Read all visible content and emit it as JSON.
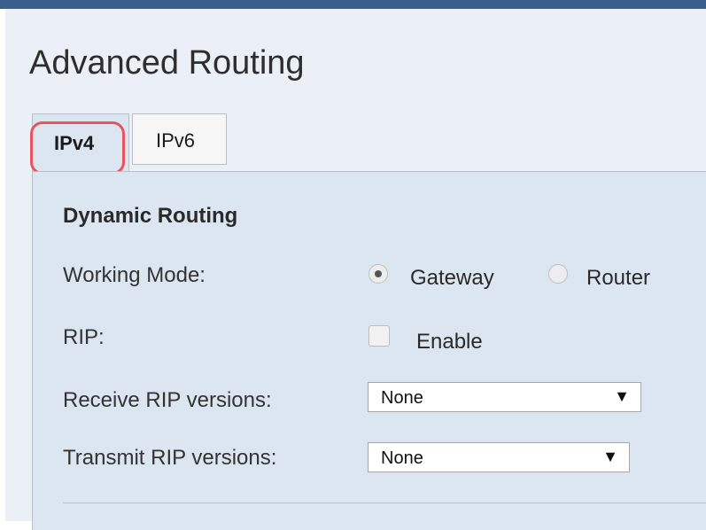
{
  "page": {
    "title": "Advanced Routing"
  },
  "tabs": [
    {
      "label": "IPv4",
      "selected": true
    },
    {
      "label": "IPv6",
      "selected": false
    }
  ],
  "dynamic_routing": {
    "section_title": "Dynamic Routing",
    "working_mode": {
      "label": "Working Mode:",
      "options": [
        "Gateway",
        "Router"
      ],
      "selected": "Gateway"
    },
    "rip": {
      "label": "RIP:",
      "checkbox_label": "Enable",
      "checked": false
    },
    "receive_rip_versions": {
      "label": "Receive RIP versions:",
      "value": "None"
    },
    "transmit_rip_versions": {
      "label": "Transmit RIP versions:",
      "value": "None"
    },
    "dropdown_arrow": "▼"
  },
  "colors": {
    "accent_bar": "#3a5f8e",
    "panel_bg": "#dce6f1",
    "highlight": "#e8535c"
  }
}
